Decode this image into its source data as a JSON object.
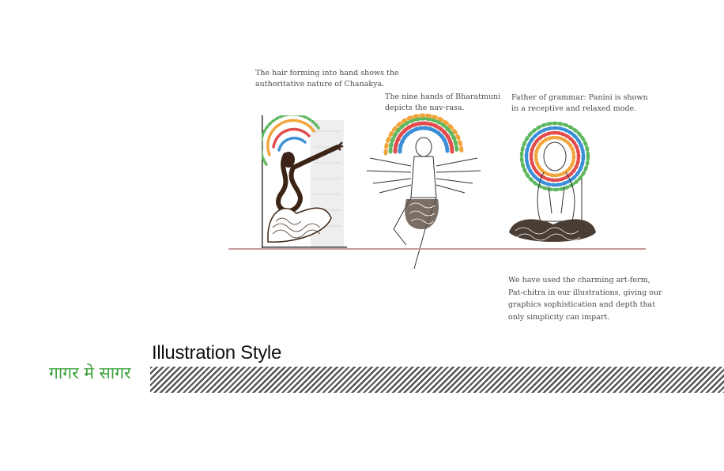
{
  "captions": {
    "chanakya": [
      "The hair forming into hand shows the",
      "authoritative nature of Chanakya."
    ],
    "bharatmuni": [
      "The nine hands of Bharatmuni",
      "depicts the nav-rasa."
    ],
    "panini": [
      "Father of grammar: Panini is shown",
      "in a receptive and relaxed mode."
    ],
    "patchitra": [
      "We have used the charming art-form,",
      "Pat-chitra in our illustrations, giving our",
      "graphics sophistication and depth that",
      "only simplicity can impart."
    ]
  },
  "section": {
    "title": "Illustration Style",
    "hindi_tagline": "गागर मे सागर"
  },
  "colors": {
    "accent_green": "#3aa03a",
    "baseline": "#c79a9a",
    "stripe": "#555555"
  }
}
